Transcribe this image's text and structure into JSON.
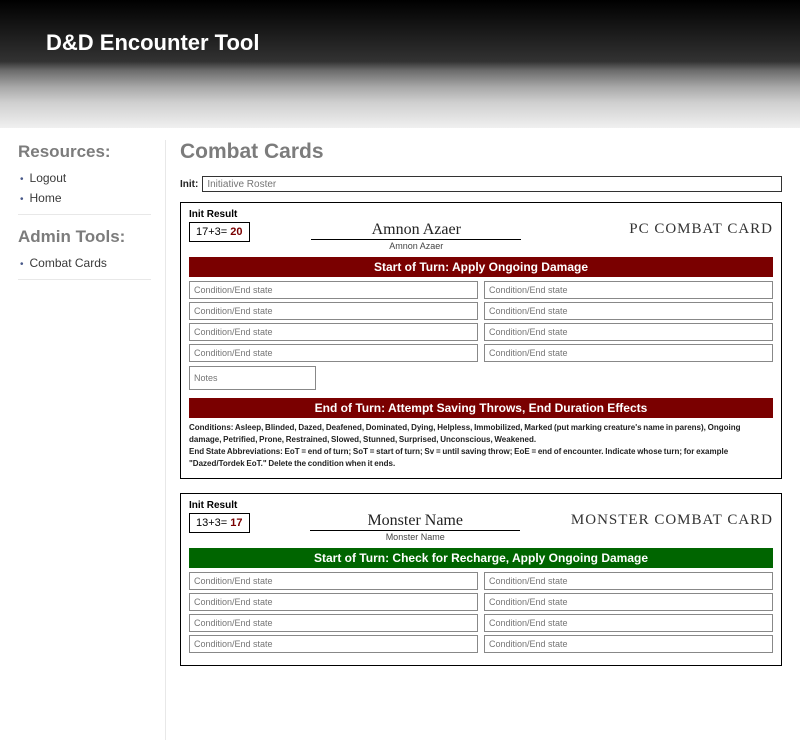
{
  "app_title": "D&D Encounter Tool",
  "sidebar": {
    "resources_heading": "Resources:",
    "resources": [
      "Logout",
      "Home"
    ],
    "admin_heading": "Admin Tools:",
    "admin": [
      "Combat Cards"
    ]
  },
  "page_title": "Combat Cards",
  "init_label": "Init:",
  "init_placeholder": "Initiative Roster",
  "cond_placeholder": "Condition/End state",
  "notes_placeholder": "Notes",
  "cards": {
    "pc": {
      "init_res_label": "Init Result",
      "init_roll": "17+3=",
      "init_total": "20",
      "name": "Amnon Azaer",
      "name_sub": "Amnon Azaer",
      "type_label": "PC COMBAT CARD",
      "start_bar": "Start of Turn: Apply Ongoing Damage",
      "end_bar": "End of Turn: Attempt Saving Throws, End Duration Effects",
      "footnote_conditions": "Conditions: Asleep, Blinded, Dazed, Deafened, Dominated, Dying, Helpless, Immobilized, Marked (put marking creature's name in parens), Ongoing damage, Petrified, Prone, Restrained, Slowed, Stunned, Surprised, Unconscious, Weakened.",
      "footnote_abbrev": "End State Abbreviations: EoT = end of turn; SoT = start of turn; Sv = until saving throw; EoE = end of encounter. Indicate whose turn; for example \"Dazed/Tordek EoT.\" Delete the condition when it ends."
    },
    "monster": {
      "init_res_label": "Init Result",
      "init_roll": "13+3=",
      "init_total": "17",
      "name": "Monster Name",
      "name_sub": "Monster Name",
      "type_label": "MONSTER COMBAT CARD",
      "start_bar": "Start of Turn: Check for Recharge, Apply Ongoing Damage"
    }
  }
}
